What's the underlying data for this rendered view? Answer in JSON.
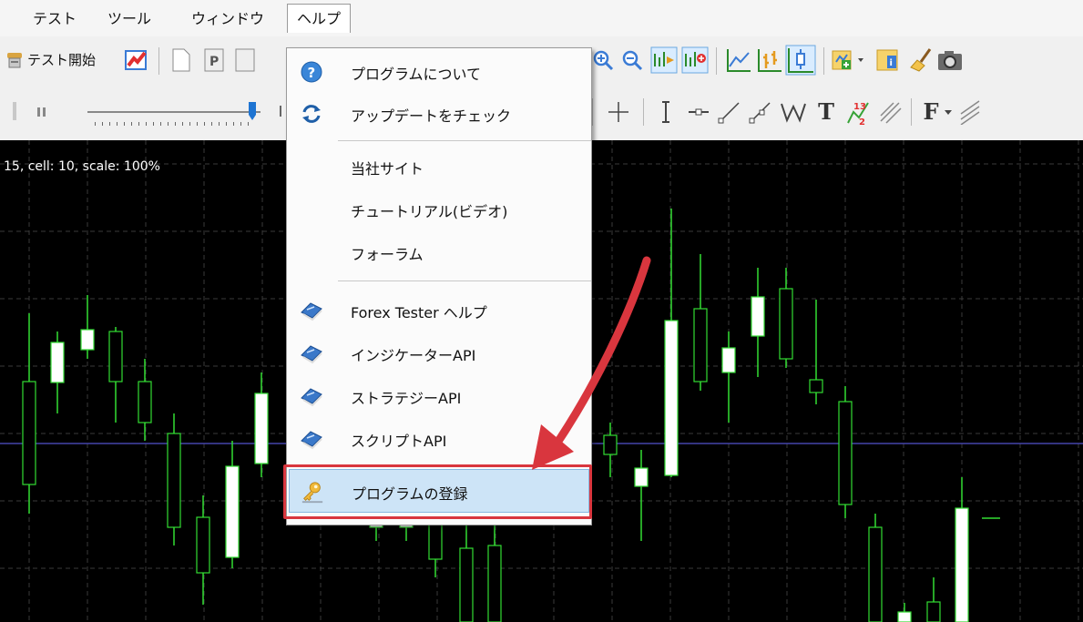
{
  "menubar": {
    "items": [
      "テスト",
      "ツール",
      "ウィンドウ",
      "ヘルプ"
    ],
    "open_index": 3
  },
  "toolbar": {
    "start_test_label": "テスト開始",
    "text_tool_label": "T",
    "fibo_label": "F"
  },
  "chart": {
    "info": "15, cell: 10, scale: 100%",
    "bull_color": "#ffffff",
    "bear_color": "#000000",
    "wick_color": "#33dd33",
    "grid_color": "#3a3a3a",
    "line_color": "#4444aa"
  },
  "help_menu": {
    "items": [
      {
        "label": "プログラムについて",
        "icon": "help-icon"
      },
      {
        "label": "アップデートをチェック",
        "icon": "update-icon"
      },
      {
        "label": "当社サイト",
        "icon": ""
      },
      {
        "label": "チュートリアル(ビデオ)",
        "icon": ""
      },
      {
        "label": "フォーラム",
        "icon": ""
      },
      {
        "label": "Forex Tester ヘルプ",
        "icon": "book-icon"
      },
      {
        "label": "インジケーターAPI",
        "icon": "book-icon"
      },
      {
        "label": "ストラテジーAPI",
        "icon": "book-icon"
      },
      {
        "label": "スクリプトAPI",
        "icon": "book-icon"
      },
      {
        "label": "プログラムの登録",
        "icon": "key-icon"
      }
    ],
    "highlighted_index": 9
  },
  "annotation": {
    "arrow_color": "#d9363e"
  }
}
